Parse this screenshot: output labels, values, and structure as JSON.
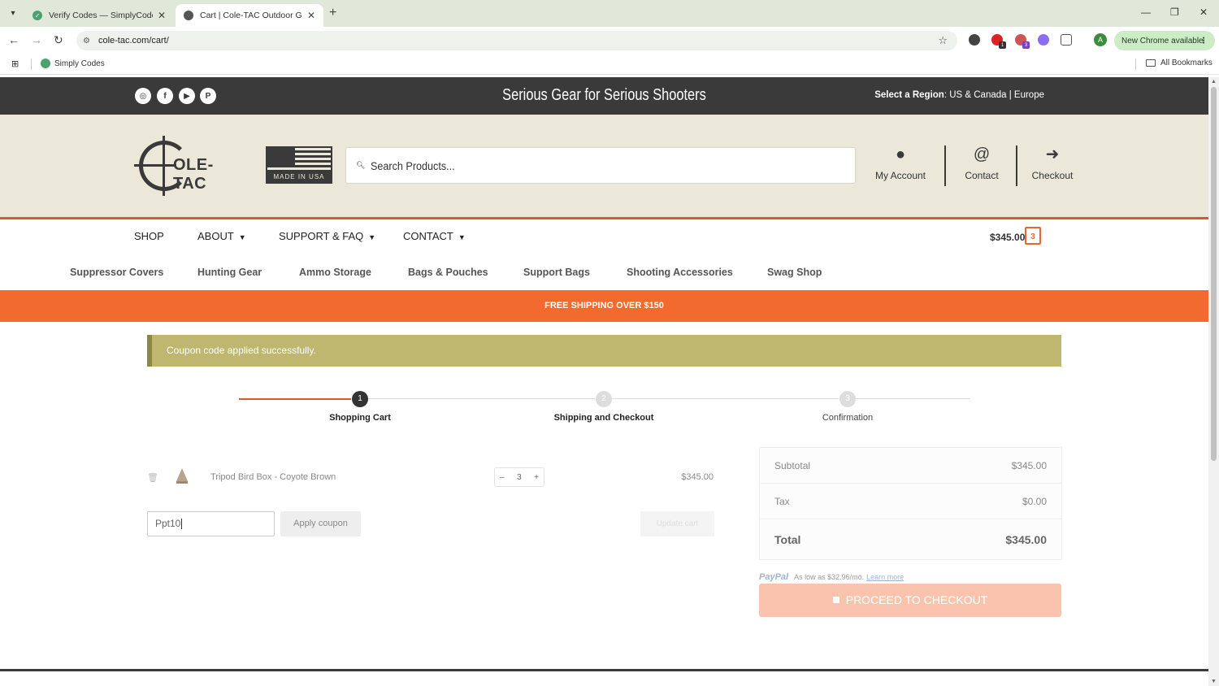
{
  "browser": {
    "tabs": [
      {
        "title": "Verify Codes — SimplyCodes",
        "active": false
      },
      {
        "title": "Cart | Cole-TAC Outdoor Gear",
        "active": true
      }
    ],
    "url": "cole-tac.com/cart/",
    "new_chrome": "New Chrome available",
    "profile_initial": "A",
    "bookmark": "Simply Codes",
    "all_bookmarks": "All Bookmarks",
    "extension_badges": [
      "1",
      "3"
    ]
  },
  "topbar": {
    "tagline": "Serious Gear for Serious Shooters",
    "region_label": "Select a Region",
    "region_options": ": US & Canada | Europe",
    "social": [
      "instagram-icon",
      "facebook-icon",
      "youtube-icon",
      "pinterest-icon"
    ]
  },
  "header": {
    "logo_text": "OLE-TAC",
    "flag_text": "MADE IN USA",
    "search_placeholder": "Search Products...",
    "links": [
      {
        "label": "My Account",
        "icon": "user-icon"
      },
      {
        "label": "Contact",
        "icon": "at-icon"
      },
      {
        "label": "Checkout",
        "icon": "arrow-circle-icon"
      }
    ]
  },
  "nav": {
    "items": [
      "SHOP",
      "ABOUT",
      "SUPPORT & FAQ",
      "CONTACT"
    ],
    "cart_total": "$345.00",
    "cart_count": "3"
  },
  "categories": [
    "Suppressor Covers",
    "Hunting Gear",
    "Ammo Storage",
    "Bags & Pouches",
    "Support Bags",
    "Shooting Accessories",
    "Swag Shop"
  ],
  "promo": "FREE SHIPPING OVER $150",
  "notice": "Coupon code applied successfully.",
  "steps": [
    {
      "num": "1",
      "label": "Shopping Cart"
    },
    {
      "num": "2",
      "label": "Shipping and Checkout"
    },
    {
      "num": "3",
      "label": "Confirmation"
    }
  ],
  "cart": {
    "item_name": "Tripod Bird Box - Coyote Brown",
    "qty": "3",
    "minus": "–",
    "plus": "+",
    "price": "$345.00",
    "coupon_value": "Ppt10",
    "apply_label": "Apply coupon",
    "update_label": "Update cart"
  },
  "totals": {
    "subtotal_label": "Subtotal",
    "subtotal": "$345.00",
    "tax_label": "Tax",
    "tax": "$0.00",
    "total_label": "Total",
    "total": "$345.00"
  },
  "paypal": {
    "brand": "PayPal",
    "text": "As low as $32.96/mo.",
    "learn_more": "Learn more"
  },
  "checkout_label": "PROCEED TO CHECKOUT",
  "colors": {
    "accent": "#f26a2e",
    "dark": "#3a3a3a",
    "notice": "#bfb66f",
    "header_bg": "#ebe8da"
  }
}
